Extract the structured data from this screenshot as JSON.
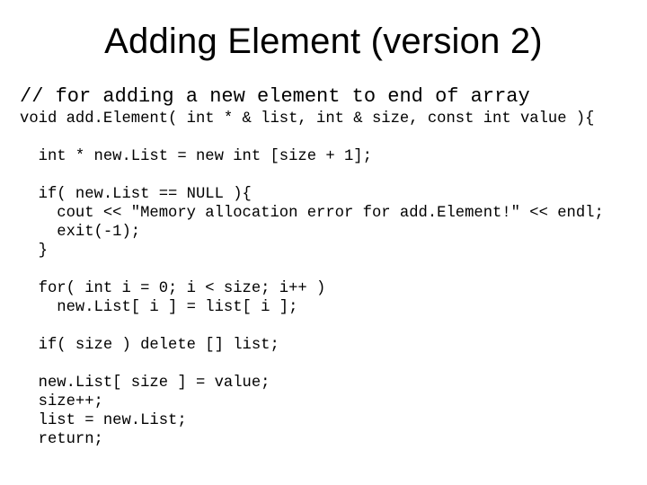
{
  "title": "Adding Element (version 2)",
  "comment": "// for adding a new element to end of array",
  "code": "void add.Element( int * & list, int & size, const int value ){\n\n  int * new.List = new int [size + 1];\n\n  if( new.List == NULL ){\n    cout << \"Memory allocation error for add.Element!\" << endl;\n    exit(-1);\n  }\n\n  for( int i = 0; i < size; i++ )\n    new.List[ i ] = list[ i ];\n\n  if( size ) delete [] list;\n\n  new.List[ size ] = value;\n  size++;\n  list = new.List;\n  return;"
}
